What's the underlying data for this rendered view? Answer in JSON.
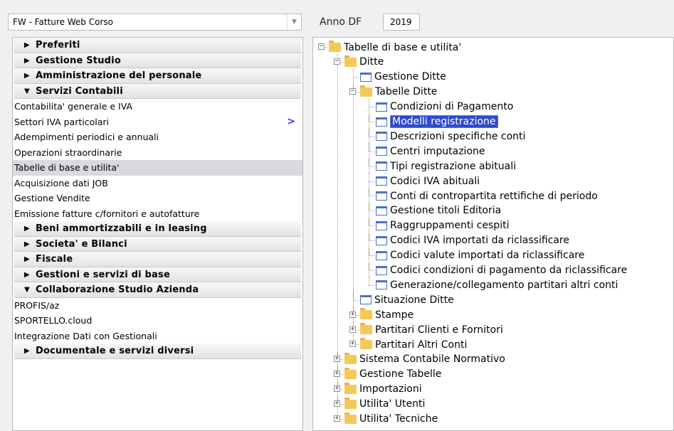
{
  "top": {
    "combo_value": "FW - Fatture Web Corso",
    "anno_label": "Anno DF",
    "anno_value": "2019"
  },
  "menu": [
    {
      "type": "section",
      "label": "Preferiti",
      "expanded": false
    },
    {
      "type": "section",
      "label": "Gestione Studio",
      "expanded": false
    },
    {
      "type": "section",
      "label": "Amministrazione del personale",
      "expanded": false
    },
    {
      "type": "section",
      "label": "Servizi Contabili",
      "expanded": true
    },
    {
      "type": "item",
      "label": "Contabilita' generale e IVA"
    },
    {
      "type": "item",
      "label": "Settori IVA particolari",
      "chevron": ">"
    },
    {
      "type": "item",
      "label": "Adempimenti periodici e annuali"
    },
    {
      "type": "item",
      "label": "Operazioni straordinarie"
    },
    {
      "type": "item",
      "label": "Tabelle di base e utilita'",
      "selected": true
    },
    {
      "type": "item",
      "label": "Acquisizione dati JOB"
    },
    {
      "type": "item",
      "label": "Gestione Vendite"
    },
    {
      "type": "item",
      "label": "Emissione fatture c/fornitori e autofatture"
    },
    {
      "type": "section",
      "label": "Beni ammortizzabili e in leasing",
      "expanded": false
    },
    {
      "type": "section",
      "label": "Societa' e Bilanci",
      "expanded": false
    },
    {
      "type": "section",
      "label": "Fiscale",
      "expanded": false
    },
    {
      "type": "section",
      "label": "Gestioni e servizi di base",
      "expanded": false
    },
    {
      "type": "section",
      "label": "Collaborazione Studio Azienda",
      "expanded": true
    },
    {
      "type": "item",
      "label": "PROFIS/az"
    },
    {
      "type": "item",
      "label": "SPORTELLO.cloud"
    },
    {
      "type": "item",
      "label": "Integrazione Dati con Gestionali"
    },
    {
      "type": "section",
      "label": "Documentale e servizi diversi",
      "expanded": false
    }
  ],
  "tree": [
    {
      "label": "Tabelle di base e utilita'",
      "icon": "folder",
      "level": 0,
      "expander": "minus"
    },
    {
      "label": "Ditte",
      "icon": "folder",
      "level": 1,
      "expander": "minus"
    },
    {
      "label": "Gestione Ditte",
      "icon": "document",
      "level": 2
    },
    {
      "label": "Tabelle Ditte",
      "icon": "folder",
      "level": 2,
      "expander": "minus"
    },
    {
      "label": "Condizioni di Pagamento",
      "icon": "document",
      "level": 3
    },
    {
      "label": "Modelli registrazione",
      "icon": "document",
      "level": 3,
      "selected": true
    },
    {
      "label": "Descrizioni specifiche conti",
      "icon": "document",
      "level": 3
    },
    {
      "label": "Centri imputazione",
      "icon": "document",
      "level": 3
    },
    {
      "label": "Tipi registrazione abituali",
      "icon": "document",
      "level": 3
    },
    {
      "label": "Codici IVA abituali",
      "icon": "document",
      "level": 3
    },
    {
      "label": "Conti di contropartita rettifiche di periodo",
      "icon": "document",
      "level": 3
    },
    {
      "label": "Gestione titoli Editoria",
      "icon": "document",
      "level": 3
    },
    {
      "label": "Raggruppamenti cespiti",
      "icon": "document",
      "level": 3
    },
    {
      "label": "Codici IVA importati da riclassificare",
      "icon": "document",
      "level": 3
    },
    {
      "label": "Codici valute importati da riclassificare",
      "icon": "document",
      "level": 3
    },
    {
      "label": "Codici condizioni di pagamento da riclassificare",
      "icon": "document",
      "level": 3
    },
    {
      "label": "Generazione/collegamento partitari altri conti",
      "icon": "document",
      "level": 3
    },
    {
      "label": "Situazione Ditte",
      "icon": "document",
      "level": 2
    },
    {
      "label": "Stampe",
      "icon": "folder",
      "level": 2,
      "expander": "plus"
    },
    {
      "label": "Partitari Clienti e Fornitori",
      "icon": "folder",
      "level": 2,
      "expander": "plus"
    },
    {
      "label": "Partitari Altri Conti",
      "icon": "folder",
      "level": 2,
      "expander": "plus"
    },
    {
      "label": "Sistema Contabile Normativo",
      "icon": "folder",
      "level": 1,
      "expander": "plus"
    },
    {
      "label": "Gestione Tabelle",
      "icon": "folder",
      "level": 1,
      "expander": "plus"
    },
    {
      "label": "Importazioni",
      "icon": "folder",
      "level": 1,
      "expander": "plus"
    },
    {
      "label": "Utilita' Utenti",
      "icon": "folder",
      "level": 1,
      "expander": "plus"
    },
    {
      "label": "Utilita' Tecniche",
      "icon": "folder",
      "level": 1,
      "expander": "plus"
    }
  ]
}
